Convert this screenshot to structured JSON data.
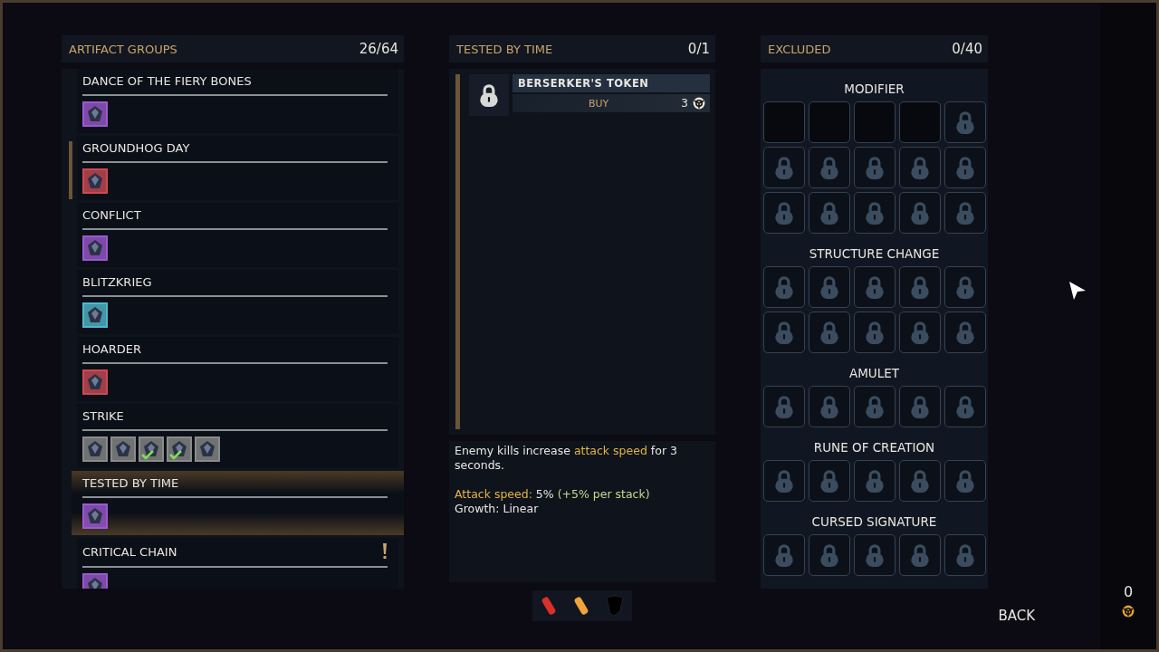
{
  "groups_panel": {
    "title": "ARTIFACT GROUPS",
    "count": "26/64"
  },
  "groups": [
    {
      "title": "DANCE OF THE FIERY BONES",
      "selected": false,
      "alert": false,
      "items": [
        {
          "color": "#9b59d0",
          "owned": false
        }
      ]
    },
    {
      "title": "GROUNDHOG DAY",
      "selected": false,
      "alert": false,
      "items": [
        {
          "color": "#c94a55",
          "owned": false
        }
      ]
    },
    {
      "title": "CONFLICT",
      "selected": false,
      "alert": false,
      "items": [
        {
          "color": "#9b59d0",
          "owned": false
        }
      ]
    },
    {
      "title": "BLITZKRIEG",
      "selected": false,
      "alert": false,
      "items": [
        {
          "color": "#4fb8cc",
          "owned": false
        }
      ]
    },
    {
      "title": "HOARDER",
      "selected": false,
      "alert": false,
      "items": [
        {
          "color": "#c94a55",
          "owned": false
        }
      ]
    },
    {
      "title": "STRIKE",
      "selected": false,
      "alert": false,
      "items": [
        {
          "color": "#8a8a8a",
          "owned": false
        },
        {
          "color": "#8a8a8a",
          "owned": false
        },
        {
          "color": "#8a8a8a",
          "owned": true
        },
        {
          "color": "#8a8a8a",
          "owned": true
        },
        {
          "color": "#8a8a8a",
          "owned": false
        }
      ]
    },
    {
      "title": "TESTED BY TIME",
      "selected": true,
      "alert": false,
      "items": [
        {
          "color": "#9b59d0",
          "owned": false
        }
      ]
    },
    {
      "title": "CRITICAL CHAIN",
      "selected": false,
      "alert": true,
      "items": [
        {
          "color": "#9b59d0",
          "owned": false
        }
      ]
    }
  ],
  "detail_panel": {
    "title": "TESTED BY TIME",
    "count": "0/1"
  },
  "artifact": {
    "name": "BERSERKER'S TOKEN",
    "action": "BUY",
    "price": "3",
    "locked": true
  },
  "description": [
    [
      {
        "text": "Enemy kills increase ",
        "kind": "plain"
      },
      {
        "text": "attack speed",
        "kind": "key"
      },
      {
        "text": " for 3 seconds.",
        "kind": "plain"
      }
    ],
    [
      {
        "text": "Attack speed: ",
        "kind": "key"
      },
      {
        "text": "5% ",
        "kind": "plain"
      },
      {
        "text": "(+5% per stack)",
        "kind": "bonus"
      }
    ],
    [
      {
        "text": "Growth: Linear",
        "kind": "plain"
      }
    ]
  ],
  "excluded_panel": {
    "title": "EXCLUDED",
    "count": "0/40"
  },
  "excluded_sections": [
    {
      "title": "MODIFIER",
      "slots": [
        {
          "locked": false
        },
        {
          "locked": false
        },
        {
          "locked": false
        },
        {
          "locked": false
        },
        {
          "locked": true
        },
        {
          "locked": true
        },
        {
          "locked": true
        },
        {
          "locked": true
        },
        {
          "locked": true
        },
        {
          "locked": true
        },
        {
          "locked": true
        },
        {
          "locked": true
        },
        {
          "locked": true
        },
        {
          "locked": true
        },
        {
          "locked": true
        }
      ]
    },
    {
      "title": "STRUCTURE CHANGE",
      "slots": [
        {
          "locked": true
        },
        {
          "locked": true
        },
        {
          "locked": true
        },
        {
          "locked": true
        },
        {
          "locked": true
        },
        {
          "locked": true
        },
        {
          "locked": true
        },
        {
          "locked": true
        },
        {
          "locked": true
        },
        {
          "locked": true
        }
      ]
    },
    {
      "title": "AMULET",
      "slots": [
        {
          "locked": true
        },
        {
          "locked": true
        },
        {
          "locked": true
        },
        {
          "locked": true
        },
        {
          "locked": true
        }
      ]
    },
    {
      "title": "RUNE OF CREATION",
      "slots": [
        {
          "locked": true
        },
        {
          "locked": true
        },
        {
          "locked": true
        },
        {
          "locked": true
        },
        {
          "locked": true
        }
      ]
    },
    {
      "title": "CURSED SIGNATURE",
      "slots": [
        {
          "locked": true
        },
        {
          "locked": true
        },
        {
          "locked": true
        },
        {
          "locked": true
        },
        {
          "locked": true
        }
      ]
    }
  ],
  "back_button": "BACK",
  "currency": {
    "amount": "0"
  }
}
